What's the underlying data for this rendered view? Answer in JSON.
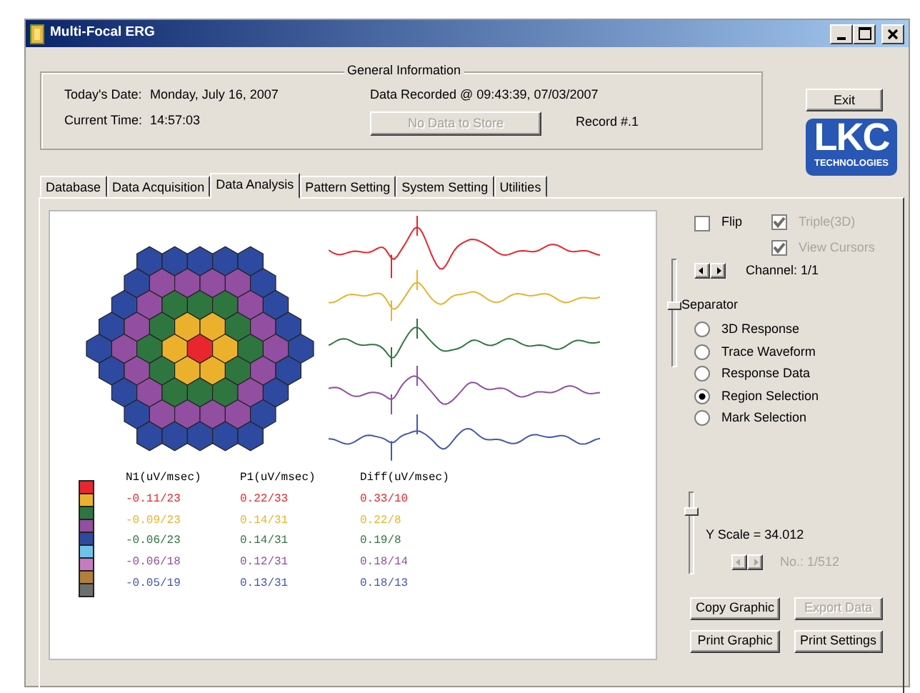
{
  "window": {
    "title": "Multi-Focal ERG"
  },
  "general_info": {
    "title": "General Information",
    "date_label": "Today's Date:",
    "date": "Monday, July 16, 2007",
    "time_label": "Current Time:",
    "time": "14:57:03",
    "data_recorded": "Data Recorded @ 09:43:39, 07/03/2007",
    "store_button": {
      "label": "No Data to Store",
      "disabled": true
    },
    "record": "Record #.1"
  },
  "exit_button": "Exit",
  "logo": {
    "text": "LKC",
    "subtitle": "TECHNOLOGIES"
  },
  "tabs": [
    {
      "label": "Database",
      "selected": false
    },
    {
      "label": "Data Acquisition",
      "selected": false
    },
    {
      "label": "Data Analysis",
      "selected": true
    },
    {
      "label": "Pattern Setting",
      "selected": false
    },
    {
      "label": "System Setting",
      "selected": false
    },
    {
      "label": "Utilities",
      "selected": false
    }
  ],
  "hex_map": {
    "rings": [
      {
        "color": "#e8262e"
      },
      {
        "color": "#ecb12c"
      },
      {
        "color": "#2f7540"
      },
      {
        "color": "#924ea0"
      },
      {
        "color": "#2e4aa0"
      }
    ]
  },
  "color_key": [
    {
      "color": "#e8262e"
    },
    {
      "color": "#ecb12c"
    },
    {
      "color": "#2f7540"
    },
    {
      "color": "#924ea0"
    },
    {
      "color": "#2e4aa0"
    },
    {
      "color": "#6ec3ea"
    },
    {
      "color": "#c67abf"
    },
    {
      "color": "#b07f3c"
    },
    {
      "color": "#6d6f6e"
    }
  ],
  "results_table": {
    "columns": [
      "N1(uV/msec)",
      "P1(uV/msec)",
      "Diff(uV/msec)"
    ],
    "rows": [
      {
        "color": "#e8262e",
        "cells": [
          "-0.11/23",
          "0.22/33",
          "0.33/10"
        ]
      },
      {
        "color": "#ecb12c",
        "cells": [
          "-0.09/23",
          "0.14/31",
          "0.22/8"
        ]
      },
      {
        "color": "#2f7540",
        "cells": [
          "-0.06/23",
          "0.14/31",
          "0.19/8"
        ]
      },
      {
        "color": "#924ea0",
        "cells": [
          "-0.06/18",
          "0.12/31",
          "0.18/14"
        ]
      },
      {
        "color": "#4457b0",
        "cells": [
          "-0.05/19",
          "0.13/31",
          "0.18/13"
        ]
      }
    ]
  },
  "options": {
    "flip": {
      "label": "Flip",
      "checked": false,
      "disabled": false
    },
    "triple_3d": {
      "label": "Triple(3D)",
      "checked": true,
      "disabled": true
    },
    "view_cursors": {
      "label": "View Cursors",
      "checked": true,
      "disabled": true
    }
  },
  "channel": "Channel: 1/1",
  "separator_slider": {
    "label": "Separator",
    "level": 0.58
  },
  "display_modes": [
    {
      "label": "3D Response",
      "selected": false
    },
    {
      "label": "Trace Waveform",
      "selected": false
    },
    {
      "label": "Response Data",
      "selected": false
    },
    {
      "label": "Region Selection",
      "selected": true
    },
    {
      "label": "Mark Selection",
      "selected": false
    }
  ],
  "y_scale_slider": {
    "label": "Y Scale = 34.012",
    "level": 0.8
  },
  "number": {
    "label": "No.: 1/512",
    "disabled": true
  },
  "buttons": [
    {
      "label": "Copy Graphic",
      "disabled": false
    },
    {
      "label": "Export Data",
      "disabled": true
    },
    {
      "label": "Print Graphic",
      "disabled": false
    },
    {
      "label": "Print Settings",
      "disabled": false
    }
  ]
}
